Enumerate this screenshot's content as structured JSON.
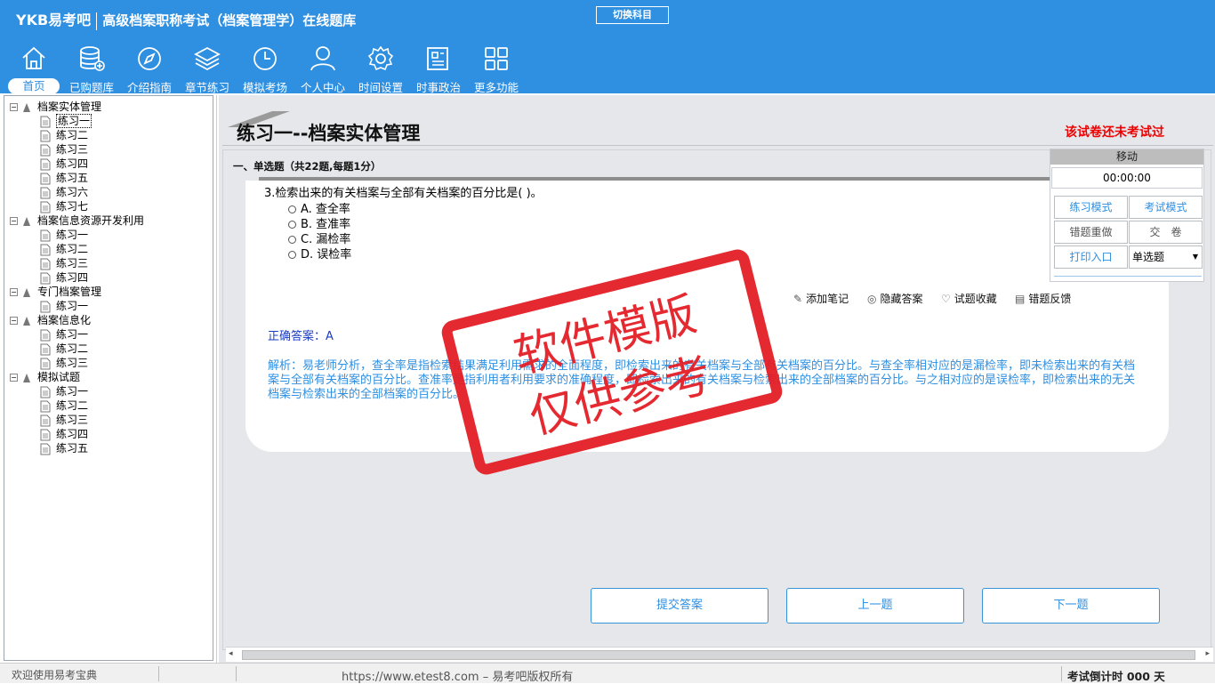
{
  "app": {
    "brand": "YKB易考吧",
    "title": "高级档案职称考试（档案管理学）在线题库",
    "switch_label": "切换科目"
  },
  "nav": [
    {
      "label": "首页",
      "icon": "home-icon"
    },
    {
      "label": "已购题库",
      "icon": "database-icon"
    },
    {
      "label": "介绍指南",
      "icon": "compass-icon"
    },
    {
      "label": "章节练习",
      "icon": "layers-icon"
    },
    {
      "label": "模拟考场",
      "icon": "clock-icon"
    },
    {
      "label": "个人中心",
      "icon": "user-icon"
    },
    {
      "label": "时间设置",
      "icon": "gear-icon"
    },
    {
      "label": "时事政治",
      "icon": "news-icon"
    },
    {
      "label": "更多功能",
      "icon": "grid-icon"
    }
  ],
  "tree": [
    {
      "label": "档案实体管理",
      "children": [
        "练习一",
        "练习二",
        "练习三",
        "练习四",
        "练习五",
        "练习六",
        "练习七"
      ]
    },
    {
      "label": "档案信息资源开发利用",
      "children": [
        "练习一",
        "练习二",
        "练习三",
        "练习四"
      ]
    },
    {
      "label": "专门档案管理",
      "children": [
        "练习一"
      ]
    },
    {
      "label": "档案信息化",
      "children": [
        "练习一",
        "练习二",
        "练习三"
      ]
    },
    {
      "label": "模拟试题",
      "children": [
        "练习一",
        "练习二",
        "练习三",
        "练习四",
        "练习五"
      ]
    }
  ],
  "exam": {
    "title": "练习一--档案实体管理",
    "status": "该试卷还未考试过",
    "section": "一、单选题（共22题,每题1分）",
    "question": "3.检索出来的有关档案与全部有关档案的百分比是( )。",
    "options": [
      "A. 查全率",
      "B. 查准率",
      "C. 漏检率",
      "D. 误检率"
    ],
    "tools": [
      "添加笔记",
      "隐藏答案",
      "试题收藏",
      "错题反馈"
    ],
    "answer": "正确答案：A",
    "explanation": "解析：易老师分析，查全率是指检索结果满足利用需求的全面程度，即检索出来的有关档案与全部有关档案的百分比。与查全率相对应的是漏检率，即未检索出来的有关档案与全部有关档案的百分比。查准率是指利用者利用要求的准确程度，即检索出来的有关档案与检索出来的全部档案的百分比。与之相对应的是误检率，即检索出来的无关档案与检索出来的全部档案的百分比。",
    "buttons": {
      "submit": "提交答案",
      "prev": "上一题",
      "next": "下一题"
    }
  },
  "timer": {
    "move_label": "移动",
    "time": "00:00:00",
    "practice_mode": "练习模式",
    "exam_mode": "考试模式",
    "redo_wrong": "错题重做",
    "hand_in": "交　卷",
    "print": "打印入口",
    "type_select": "单选题"
  },
  "stamp": {
    "line1": "软件模版",
    "line2": "仅供参考"
  },
  "footer": {
    "welcome": "欢迎使用易考宝典",
    "site": "https://www.etest8.com – 易考吧版权所有",
    "countdown": "考试倒计时 000 天"
  }
}
